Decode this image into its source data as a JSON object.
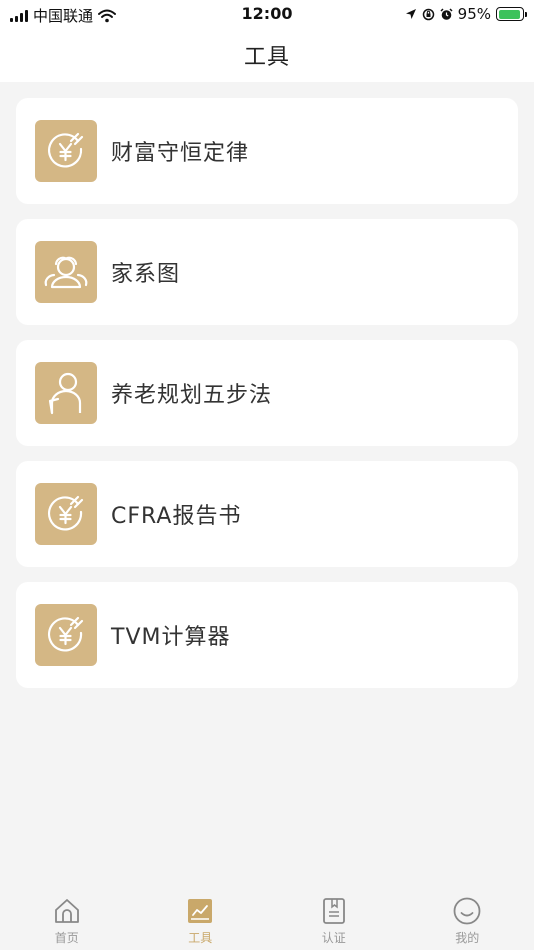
{
  "status_bar": {
    "carrier": "中国联通",
    "time": "12:00",
    "battery_percent": "95%",
    "battery_level": 0.95
  },
  "header": {
    "title": "工具"
  },
  "colors": {
    "accent": "#d4b785",
    "active_tab": "#c9a86a",
    "inactive_tab": "#999999"
  },
  "tools": [
    {
      "label": "财富守恒定律",
      "icon": "yen-coin-icon"
    },
    {
      "label": "家系图",
      "icon": "family-icon"
    },
    {
      "label": "养老规划五步法",
      "icon": "elderly-person-icon"
    },
    {
      "label": "CFRA报告书",
      "icon": "yen-coin-icon"
    },
    {
      "label": "TVM计算器",
      "icon": "yen-coin-icon"
    }
  ],
  "tabs": [
    {
      "label": "首页",
      "icon": "home-icon",
      "active": false
    },
    {
      "label": "工具",
      "icon": "chart-icon",
      "active": true
    },
    {
      "label": "认证",
      "icon": "document-icon",
      "active": false
    },
    {
      "label": "我的",
      "icon": "smiley-icon",
      "active": false
    }
  ]
}
